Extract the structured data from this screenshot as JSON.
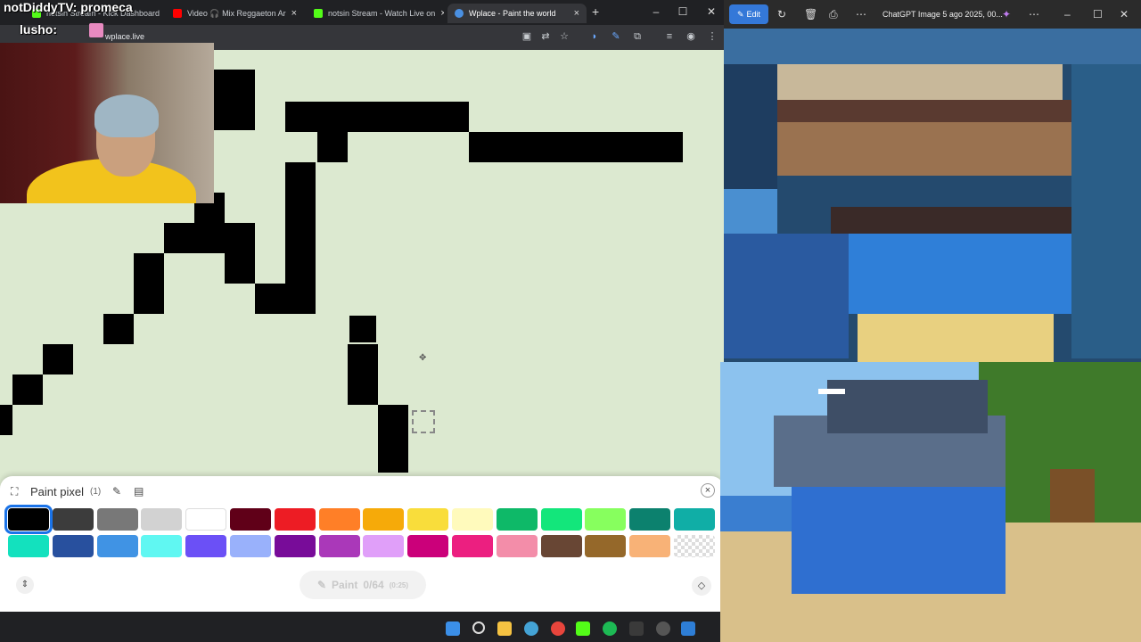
{
  "browser": {
    "tabs": [
      {
        "label": "notsin Stream - Kick Dashboard",
        "icon": "kick-icon"
      },
      {
        "label": "Video 🎧 Mix Reggaeton Ar",
        "icon": "youtube-icon"
      },
      {
        "label": "notsin Stream - Watch Live on",
        "icon": "kick-icon"
      },
      {
        "label": "Wplace - Paint the world",
        "icon": "wplace-icon"
      }
    ],
    "url": "wplace.live",
    "new_tab": "+",
    "close": "×"
  },
  "overlay": {
    "alert": "notDiddyTV: promeca",
    "chat_user": "lusho:"
  },
  "paint_panel": {
    "title": "Paint pixel",
    "count": "(1)",
    "close": "×",
    "paint_button": "Paint",
    "paint_progress": "0/64",
    "paint_time": "(0:25)",
    "colors": {
      "row1": [
        "#000000",
        "#3c3c3c",
        "#787878",
        "#d2d2d2",
        "#ffffff",
        "#600018",
        "#ed1c24",
        "#ff7f27",
        "#f6aa09",
        "#f9dd3b",
        "#fffabc",
        "#0eb968",
        "#13e67b",
        "#87ff5e",
        "#0c816e",
        "#10aea6"
      ],
      "row2": [
        "#13e1be",
        "#28509e",
        "#4093e4",
        "#60f7f2",
        "#6b50f6",
        "#99b1fb",
        "#780c99",
        "#aa38b9",
        "#e09ff9",
        "#cb007a",
        "#ec1f80",
        "#f38da9",
        "#684634",
        "#95682a",
        "#f8b277",
        "transparent"
      ]
    },
    "selected_color": "#000000"
  },
  "viewer": {
    "edit_label": "Edit",
    "title": "ChatGPT Image 5 ago 2025, 00..."
  }
}
